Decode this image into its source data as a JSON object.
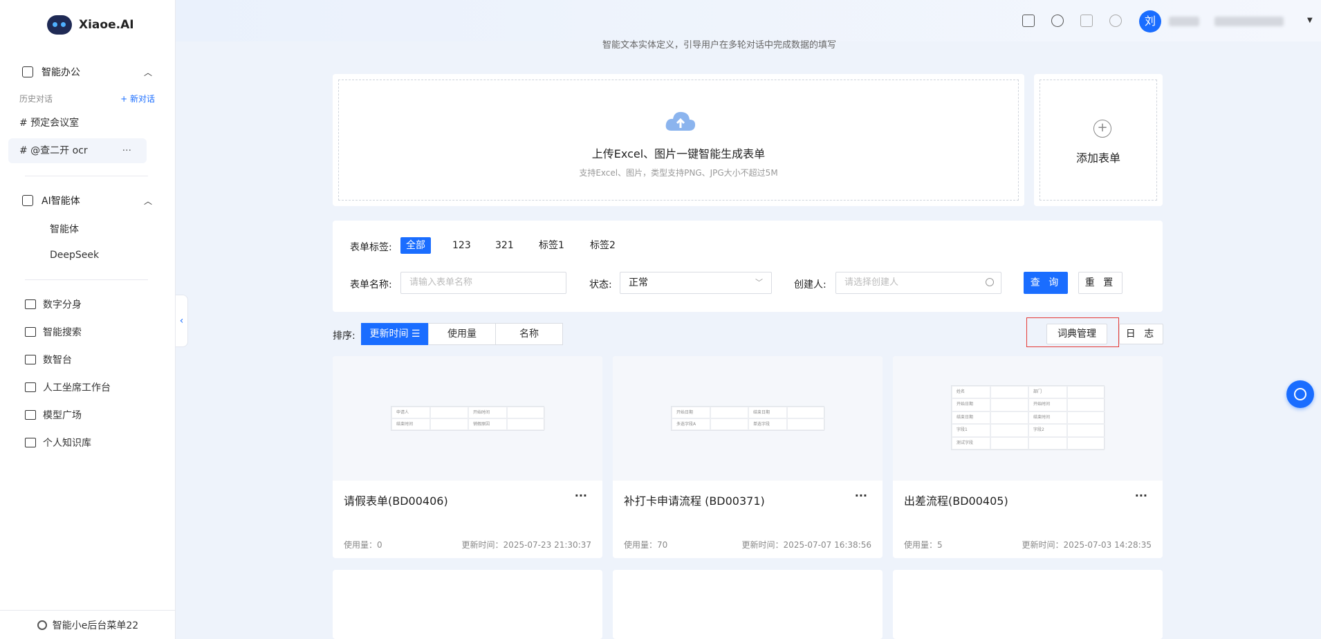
{
  "app": {
    "name": "Xiaoe.AI"
  },
  "sidebar": {
    "office_section": "智能办公",
    "history_label": "历史对话",
    "new_chat": "+ 新对话",
    "conversations": [
      "# 预定会议室",
      "# @查二开 ocr"
    ],
    "conv_more": "···",
    "agent_section": "AI智能体",
    "agents": [
      "智能体",
      "DeepSeek"
    ],
    "nav": [
      "数字分身",
      "智能搜索",
      "数智台",
      "人工坐席工作台",
      "模型广场",
      "个人知识库"
    ],
    "bottom": "智能小e后台菜单22",
    "collapse": "‹"
  },
  "header": {
    "avatar": "刘"
  },
  "subtitle": "智能文本实体定义，引导用户在多轮对话中完成数据的填写",
  "upload": {
    "title": "上传Excel、图片一键智能生成表单",
    "hint": "支持Excel、图片，类型支持PNG、JPG大小不超过5M",
    "add_label": "添加表单"
  },
  "filter": {
    "tag_label": "表单标签:",
    "tags": [
      "全部",
      "123",
      "321",
      "标签1",
      "标签2"
    ],
    "name_label": "表单名称:",
    "name_placeholder": "请输入表单名称",
    "status_label": "状态:",
    "status_value": "正常",
    "creator_label": "创建人:",
    "creator_placeholder": "请选择创建人",
    "query": "查 询",
    "reset": "重 置"
  },
  "sort": {
    "label": "排序:",
    "options": [
      "更新时间 ☰",
      "使用量",
      "名称"
    ],
    "dict": "词典管理",
    "log": "日 志"
  },
  "forms": [
    {
      "title": "请假表单(BD00406)",
      "usage": "使用量：0",
      "updated": "更新时间：2025-07-23 21:30:37",
      "thumb": [
        "申请人",
        "",
        "开始时间",
        "",
        "结束时间",
        "",
        "销假原因",
        ""
      ]
    },
    {
      "title": "补打卡申请流程 (BD00371)",
      "usage": "使用量：70",
      "updated": "更新时间：2025-07-07 16:38:56",
      "thumb": [
        "开始日期",
        "",
        "结束日期",
        "",
        "多选字段A",
        "",
        "单选字段",
        ""
      ]
    },
    {
      "title": "出差流程(BD00405)",
      "usage": "使用量：5",
      "updated": "更新时间：2025-07-03 14:28:35",
      "thumb": [
        "姓名",
        "",
        "部门",
        "",
        "开始日期",
        "",
        "开始时间",
        "",
        "结束日期",
        "",
        "结束时间",
        "",
        "字段1",
        "",
        "字段2",
        "",
        "测试字段",
        "",
        "",
        ""
      ]
    }
  ],
  "more": "···"
}
